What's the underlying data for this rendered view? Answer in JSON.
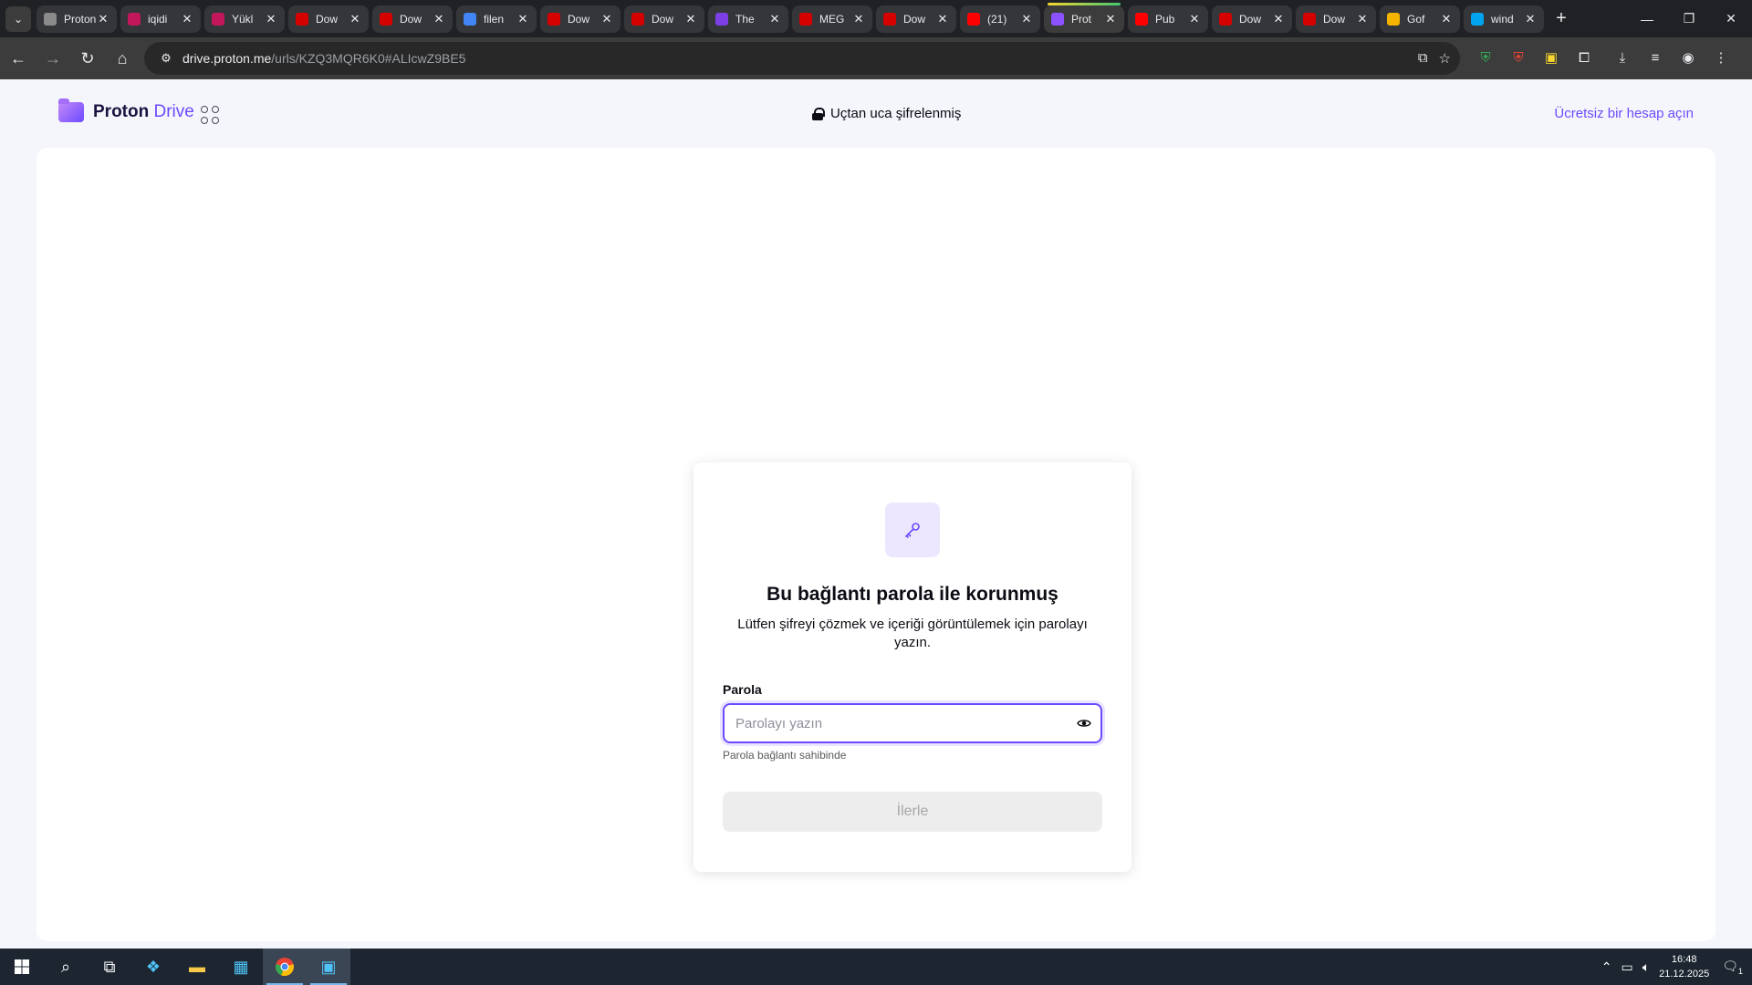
{
  "browser": {
    "tabs": [
      {
        "title": "Proton",
        "favicon_color": "#8b8b8b",
        "active": false
      },
      {
        "title": "iqidi",
        "favicon_color": "#c2185b",
        "active": false
      },
      {
        "title": "Yükl",
        "favicon_color": "#c2185b",
        "active": false
      },
      {
        "title": "Dow",
        "favicon_color": "#d50000",
        "active": false
      },
      {
        "title": "Dow",
        "favicon_color": "#d50000",
        "active": false
      },
      {
        "title": "filen",
        "favicon_color": "#4285f4",
        "active": false
      },
      {
        "title": "Dow",
        "favicon_color": "#d50000",
        "active": false
      },
      {
        "title": "Dow",
        "favicon_color": "#d50000",
        "active": false
      },
      {
        "title": "The",
        "favicon_color": "#7b3fe4",
        "active": false
      },
      {
        "title": "MEG",
        "favicon_color": "#d50000",
        "active": false
      },
      {
        "title": "Dow",
        "favicon_color": "#d50000",
        "active": false
      },
      {
        "title": "(21)",
        "favicon_color": "#ff0000",
        "active": false
      },
      {
        "title": "Prot",
        "favicon_color": "#8c52ff",
        "active": true
      },
      {
        "title": "Pub",
        "favicon_color": "#ff0000",
        "active": false
      },
      {
        "title": "Dow",
        "favicon_color": "#d50000",
        "active": false
      },
      {
        "title": "Dow",
        "favicon_color": "#d50000",
        "active": false
      },
      {
        "title": "Gof",
        "favicon_color": "#f4b400",
        "active": false
      },
      {
        "title": "wind",
        "favicon_color": "#00a4ef",
        "active": false
      }
    ],
    "url_host": "drive.proton.me",
    "url_path": "/urls/KZQ3MQR6K0#ALIcwZ9BE5"
  },
  "header": {
    "brand_main": "Proton",
    "brand_accent": "Drive",
    "secure_label": "Uçtan uca şifrelenmiş",
    "signup_link": "Ücretsiz bir hesap açın"
  },
  "card": {
    "title": "Bu bağlantı parola ile korunmuş",
    "subtitle": "Lütfen şifreyi çözmek ve içeriği görüntülemek için parolayı yazın.",
    "field_label": "Parola",
    "field_placeholder": "Parolayı yazın",
    "field_value": "",
    "hint": "Parola bağlantı sahibinde",
    "submit_label": "İlerle"
  },
  "taskbar": {
    "time": "16:48",
    "date": "21.12.2025",
    "notification_count": "1"
  },
  "colors": {
    "brand": "#6d4aff",
    "page_bg": "#f4f6fb"
  }
}
